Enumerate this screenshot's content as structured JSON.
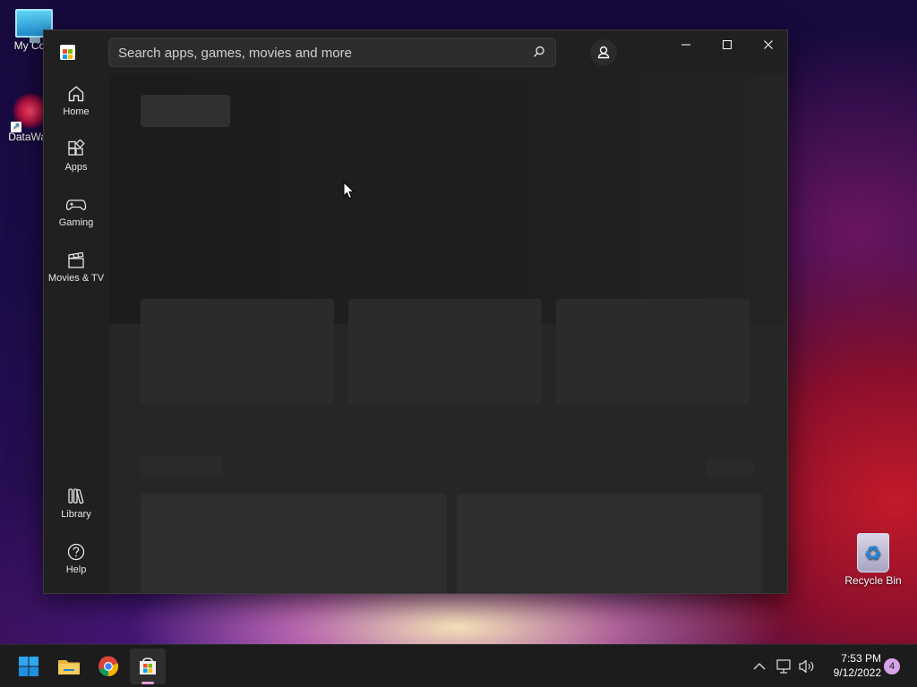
{
  "desktop": {
    "icons": [
      {
        "label": "My Com"
      },
      {
        "label": "DataWag"
      },
      {
        "label": "Recycle Bin"
      }
    ]
  },
  "store": {
    "search_placeholder": "Search apps, games, movies and more",
    "nav": {
      "home": "Home",
      "apps": "Apps",
      "gaming": "Gaming",
      "movies": "Movies & TV",
      "library": "Library",
      "help": "Help"
    }
  },
  "taskbar": {
    "time": "7:53 PM",
    "date": "9/12/2022",
    "notification_count": "4"
  },
  "colors": {
    "window_bg": "#202020",
    "content_bg": "#262626",
    "accent": "#0078d4"
  }
}
